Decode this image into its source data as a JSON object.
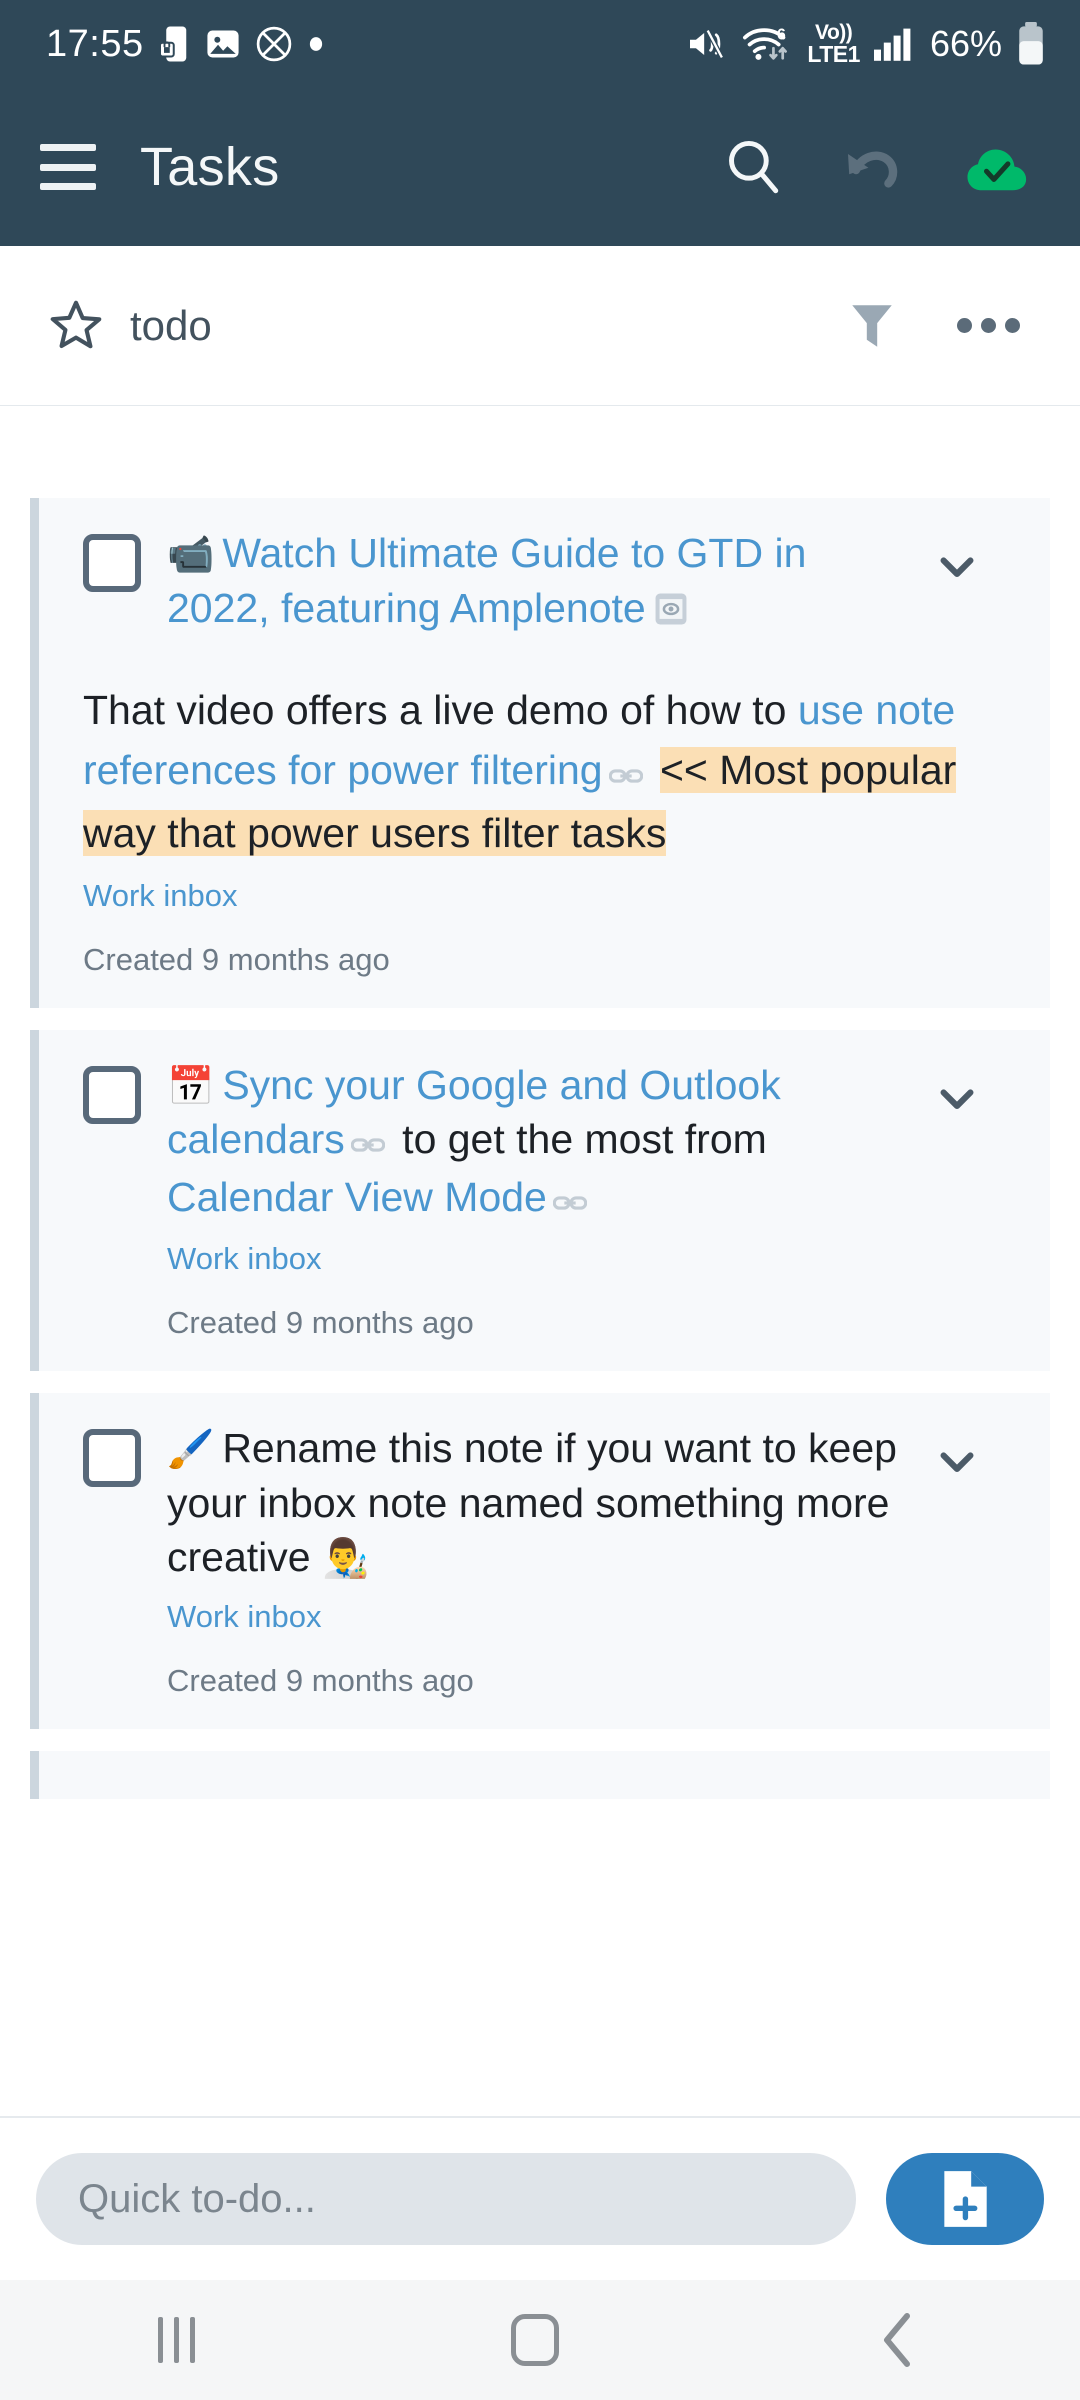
{
  "statusbar": {
    "time": "17:55",
    "left_icons": [
      "phone-lock-icon",
      "image-icon",
      "no-sim-icon",
      "dot-icon"
    ],
    "right_icons": [
      "mute-icon",
      "wifi-6-icon",
      "volte-icon",
      "signal-bars-icon"
    ],
    "wifi_label": "6",
    "volte_label_top": "Vo))",
    "volte_label_bottom": "LTE1",
    "battery_percent": "66%"
  },
  "appbar": {
    "menu_icon": "hamburger-icon",
    "title": "Tasks",
    "search_icon": "search-icon",
    "undo_icon": "undo-icon",
    "sync_icon": "cloud-check-icon",
    "sync_color": "#00b96a",
    "background": "#2f4858"
  },
  "filterbar": {
    "star_icon": "star-outline-icon",
    "name": "todo",
    "filter_icon": "funnel-icon",
    "overflow_icon": "more-horizontal-icon"
  },
  "tasks": [
    {
      "checkbox": "unchecked",
      "emoji": "📹",
      "title_link": "Watch Ultimate Guide to GTD in 2022, featuring Amplenote",
      "title_trailing_icon": "media-preview-icon",
      "description": {
        "plain1": "That video offers a live demo of how to ",
        "link1": "use note references for power filtering",
        "link_icon": "link-icon",
        "highlight": "<< Most popular way that power users filter tasks"
      },
      "source": "Work inbox",
      "created": "Created 9 months ago",
      "expand_icon": "chevron-down-icon"
    },
    {
      "checkbox": "unchecked",
      "emoji": "📅",
      "title_parts": [
        {
          "type": "link",
          "text": "Sync your Google and Outlook calendars"
        },
        {
          "type": "icon",
          "text": "link-icon"
        },
        {
          "type": "plain",
          "text": " to get the most from "
        },
        {
          "type": "link",
          "text": "Calendar View Mode"
        },
        {
          "type": "icon",
          "text": "link-icon"
        }
      ],
      "source": "Work inbox",
      "created": "Created 9 months ago",
      "expand_icon": "chevron-down-icon"
    },
    {
      "checkbox": "unchecked",
      "emoji": "🖌️",
      "title_plain": "Rename this note if you want to keep your inbox note named something more creative ",
      "title_trailing_emoji": "👨‍🎨",
      "source": "Work inbox",
      "created": "Created 9 months ago",
      "expand_icon": "chevron-down-icon"
    }
  ],
  "composer": {
    "placeholder": "Quick to-do...",
    "new_note_icon": "new-document-icon",
    "button_color": "#2f7fbd"
  },
  "navbar": {
    "recents_icon": "recents-icon",
    "home_icon": "home-icon",
    "back_icon": "back-icon"
  },
  "colors": {
    "appbar_bg": "#2f4858",
    "link": "#4a96cf",
    "highlight": "#fbdfb5",
    "card_bg": "#f7f9fb",
    "card_accent": "#ccd6de"
  }
}
